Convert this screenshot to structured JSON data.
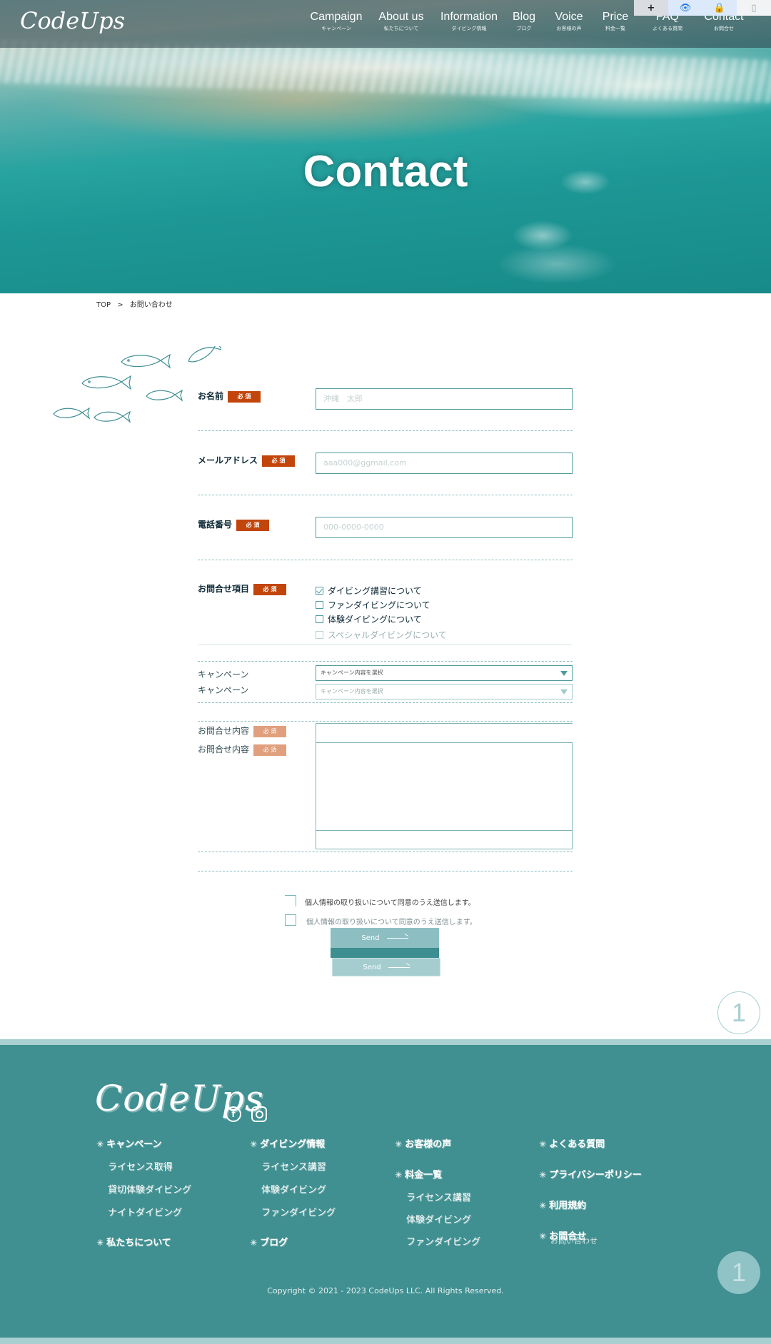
{
  "header": {
    "logo": "CodeUps",
    "nav": [
      {
        "en": "Campaign",
        "jp": "キャンペーン"
      },
      {
        "en": "About us",
        "jp": "私たちについて"
      },
      {
        "en": "Information",
        "jp": "ダイビング情報"
      },
      {
        "en": "Blog",
        "jp": "ブログ"
      },
      {
        "en": "Voice",
        "jp": "お客様の声"
      },
      {
        "en": "Price",
        "jp": "料金一覧"
      },
      {
        "en": "FAQ",
        "jp": "よくある質問"
      },
      {
        "en": "Contact",
        "jp": "お問合せ"
      }
    ],
    "toolbar": {
      "plus": "+",
      "eye": "👁",
      "lock": "🔒",
      "page": "▯"
    }
  },
  "hero": {
    "title": "Contact"
  },
  "breadcrumb": {
    "home": "TOP",
    "sep": ">",
    "current": "お問い合わせ"
  },
  "form": {
    "required": "必 須",
    "name": {
      "label": "お名前",
      "placeholder": "沖縄　太郎"
    },
    "email": {
      "label": "メールアドレス",
      "placeholder": "aaa000@ggmail.com"
    },
    "phone": {
      "label": "電話番号",
      "placeholder": "000-0000-0000"
    },
    "inquiry": {
      "label": "お問合せ項目",
      "options": [
        {
          "label": "ダイビング講習について",
          "checked": true
        },
        {
          "label": "ファンダイビングについて",
          "checked": false
        },
        {
          "label": "体験ダイビングについて",
          "checked": false
        },
        {
          "label": "スペシャルダイビングについて",
          "checked": false
        }
      ]
    },
    "campaign": {
      "label": "キャンペーン",
      "label_dup": "キャンペーン",
      "placeholder": "キャンペーン内容を選択",
      "placeholder_dup": "キャンペーン内容を選択"
    },
    "message": {
      "label": "お問合せ内容",
      "label_dup": "お問合せ内容"
    },
    "agree": {
      "text": "個人情報の取り扱いについて同意のうえ送信します。",
      "text_dup": "個人情報の取り扱いについて同意のうえ送信します。"
    },
    "send": {
      "label": "Send",
      "label_dup": "Send"
    }
  },
  "pagetop": {
    "label": "1"
  },
  "footer": {
    "logo": "CodeUps",
    "social": {
      "facebook": "f",
      "instagram": ""
    },
    "columns": [
      {
        "items": [
          {
            "head": "キャンペーン",
            "subs": [
              "ライセンス取得",
              "貸切体験ダイビング",
              "ナイトダイビング"
            ]
          },
          {
            "head": "私たちについて",
            "subs": []
          }
        ]
      },
      {
        "items": [
          {
            "head": "ダイビング情報",
            "subs": [
              "ライセンス講習",
              "体験ダイビング",
              "ファンダイビング"
            ]
          },
          {
            "head": "ブログ",
            "subs": []
          }
        ]
      },
      {
        "items": [
          {
            "head": "お客様の声",
            "subs": []
          },
          {
            "head": "料金一覧",
            "subs": [
              "ライセンス講習",
              "体験ダイビング",
              "ファンダイビング"
            ]
          }
        ]
      },
      {
        "items": [
          {
            "head": "よくある質問",
            "subs": []
          },
          {
            "head": "プライバシーポリシー",
            "subs": []
          },
          {
            "head": "利用規約",
            "subs": []
          },
          {
            "head": "お問合せ",
            "subs": []
          }
        ]
      }
    ],
    "contact_extra": "お問い合わせ",
    "copyright": "Copyright © 2021 - 2023 CodeUps LLC. All Rights Reserved."
  },
  "colors": {
    "primary": "#408f91",
    "accent": "#c2460c",
    "ink": "#0d2936"
  }
}
